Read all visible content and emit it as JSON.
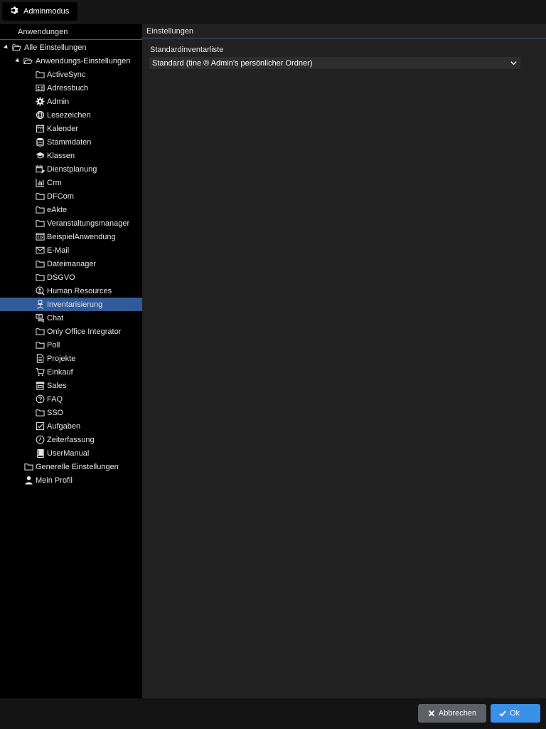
{
  "toolbar": {
    "admin_mode_label": "Adminmodus"
  },
  "left_panel": {
    "header": "Anwendungen"
  },
  "tree": {
    "root": "Alle Einstellungen",
    "app_settings": "Anwendungs-Einstellungen",
    "apps": [
      {
        "label": "ActiveSync",
        "icon": "folder-icon"
      },
      {
        "label": "Adressbuch",
        "icon": "addressbook-icon"
      },
      {
        "label": "Admin",
        "icon": "gear-icon"
      },
      {
        "label": "Lesezeichen",
        "icon": "globe-icon"
      },
      {
        "label": "Kalender",
        "icon": "calendar-icon"
      },
      {
        "label": "Stammdaten",
        "icon": "database-icon"
      },
      {
        "label": "Klassen",
        "icon": "graduation-cap-icon"
      },
      {
        "label": "Dienstplanung",
        "icon": "calendar-edit-icon"
      },
      {
        "label": "Crm",
        "icon": "bar-chart-icon"
      },
      {
        "label": "DFCom",
        "icon": "folder-icon"
      },
      {
        "label": "eAkte",
        "icon": "folder-icon"
      },
      {
        "label": "Veranstaltungsmanager",
        "icon": "folder-icon"
      },
      {
        "label": "BeispielAnwendung",
        "icon": "code-window-icon"
      },
      {
        "label": "E-Mail",
        "icon": "envelope-icon"
      },
      {
        "label": "Dateimanager",
        "icon": "folder-icon"
      },
      {
        "label": "DSGVO",
        "icon": "folder-icon"
      },
      {
        "label": "Human Resources",
        "icon": "person-search-icon"
      },
      {
        "label": "Inventarisierung",
        "icon": "office-chair-icon",
        "selected": true
      },
      {
        "label": "Chat",
        "icon": "chat-icon"
      },
      {
        "label": "Only Office Integrator",
        "icon": "folder-icon"
      },
      {
        "label": "Poll",
        "icon": "folder-icon"
      },
      {
        "label": "Projekte",
        "icon": "document-icon"
      },
      {
        "label": "Einkauf",
        "icon": "shopping-cart-icon"
      },
      {
        "label": "Sales",
        "icon": "store-icon"
      },
      {
        "label": "FAQ",
        "icon": "question-circle-icon"
      },
      {
        "label": "SSO",
        "icon": "folder-icon"
      },
      {
        "label": "Aufgaben",
        "icon": "checkbox-icon"
      },
      {
        "label": "Zeiterfassung",
        "icon": "clock-icon"
      },
      {
        "label": "UserManual",
        "icon": "book-icon"
      }
    ],
    "general_settings": "Generelle Einstellungen",
    "my_profile": "Mein Profil"
  },
  "right_panel": {
    "header": "Einstellungen",
    "field_label": "Standardinventarliste",
    "select_value": "Standard (tine ® Admin's persönlicher Ordner)"
  },
  "footer": {
    "cancel_label": "Abbrechen",
    "ok_label": "Ok"
  },
  "colors": {
    "selected": "#315a99",
    "ok_button": "#3a8fe6",
    "cancel_button": "#5d6166",
    "panel": "#222222"
  }
}
